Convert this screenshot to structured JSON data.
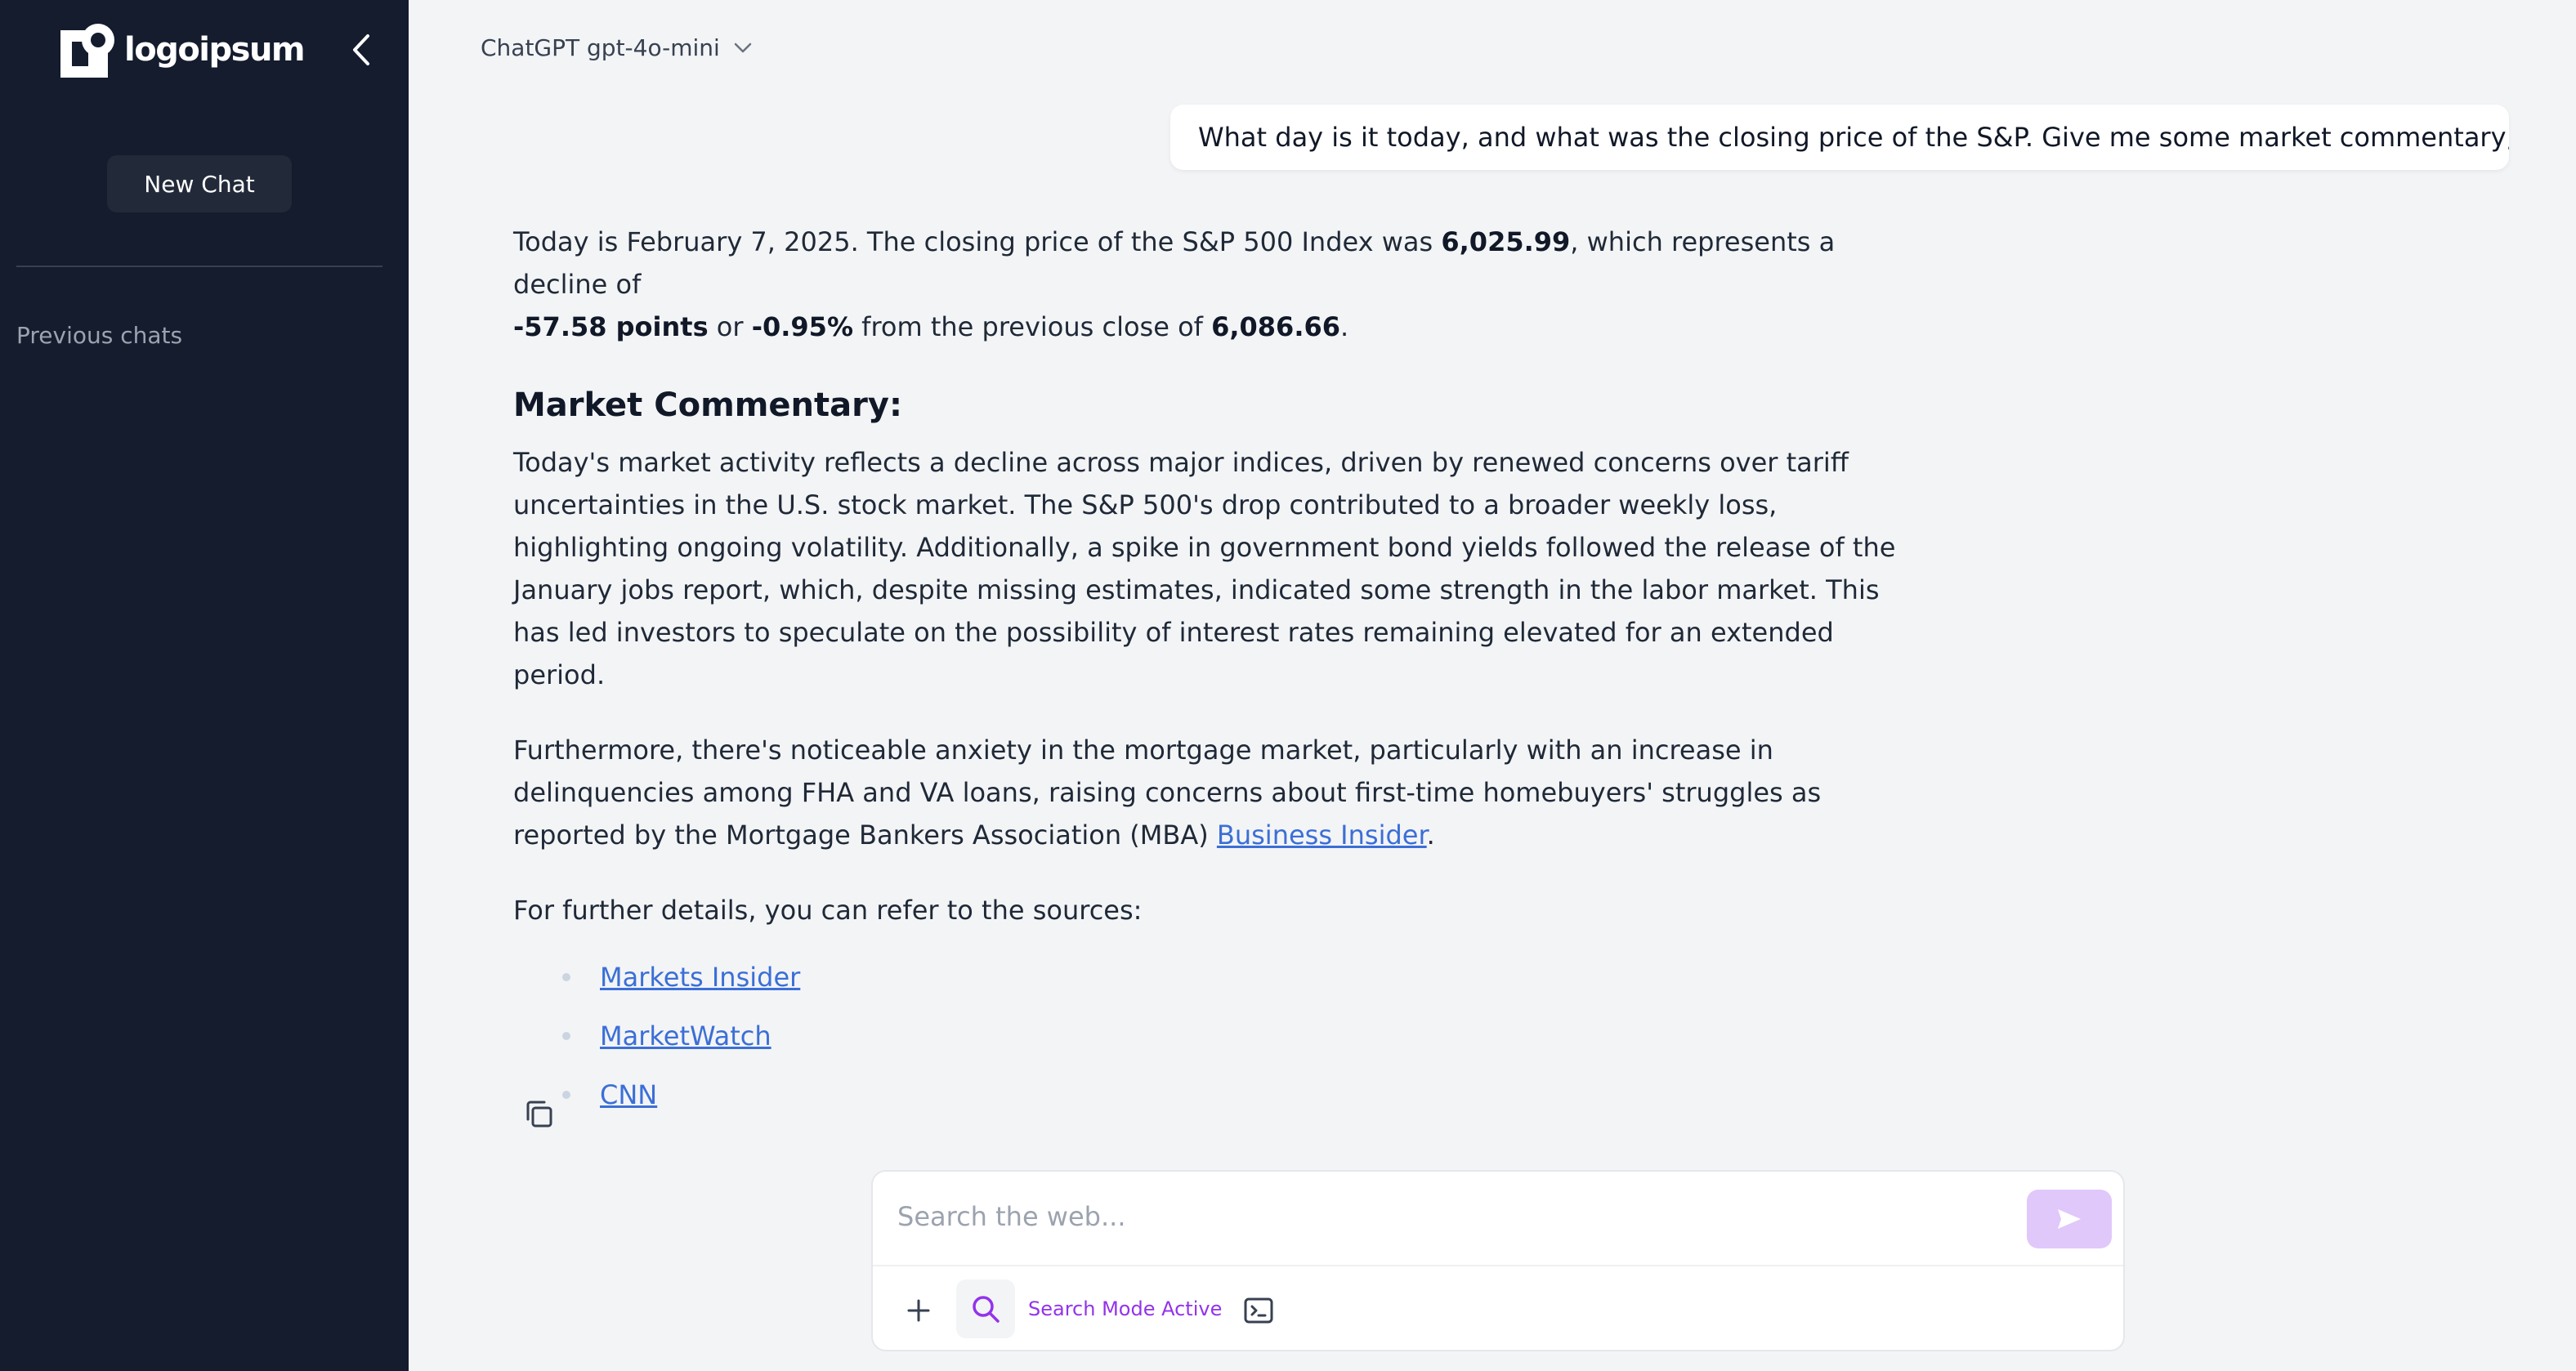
{
  "sidebar": {
    "logo_text": "logoipsum",
    "new_chat_label": "New Chat",
    "previous_chats_label": "Previous chats"
  },
  "header": {
    "model_label": "ChatGPT gpt-4o-mini"
  },
  "conversation": {
    "user_message": "What day is it today, and what was the closing price of the S&P. Give me some market commentary, too.",
    "assistant": {
      "intro": {
        "t1": "Today is February 7, 2025. The closing price of the S&P 500 Index was ",
        "b1": "6,025.99",
        "t2": ", which represents a decline of ",
        "b2": "-57.58 points",
        "t3": " or ",
        "b3": "-0.95%",
        "t4": " from the previous close of ",
        "b4": "6,086.66",
        "t5": "."
      },
      "heading": "Market Commentary:",
      "paragraph1": "Today's market activity reflects a decline across major indices, driven by renewed concerns over tariff uncertainties in the U.S. stock market. The S&P 500's drop contributed to a broader weekly loss, highlighting ongoing volatility. Additionally, a spike in government bond yields followed the release of the January jobs report, which, despite missing estimates, indicated some strength in the labor market. This has led investors to speculate on the possibility of interest rates remaining elevated for an extended period.",
      "paragraph2_text": "Furthermore, there's noticeable anxiety in the mortgage market, particularly with an increase in delinquencies among FHA and VA loans, raising concerns about first-time homebuyers' struggles as reported by the Mortgage Bankers Association (MBA) ",
      "paragraph2_link": "Business Insider",
      "paragraph2_end": ".",
      "sources_intro": "For further details, you can refer to the sources:",
      "sources": [
        "Markets Insider",
        "MarketWatch",
        "CNN"
      ]
    }
  },
  "composer": {
    "placeholder": "Search the web...",
    "search_mode_label": "Search Mode Active"
  },
  "colors": {
    "sidebar_bg": "#141c2e",
    "main_bg": "#f3f4f6",
    "link": "#3b6fd6",
    "accent_purple": "#9333ea",
    "send_button": "#e0c8fb"
  },
  "icons": [
    "logo-icon",
    "chevron-left-icon",
    "chevron-down-icon",
    "copy-icon",
    "send-icon",
    "plus-icon",
    "search-icon",
    "terminal-icon"
  ]
}
